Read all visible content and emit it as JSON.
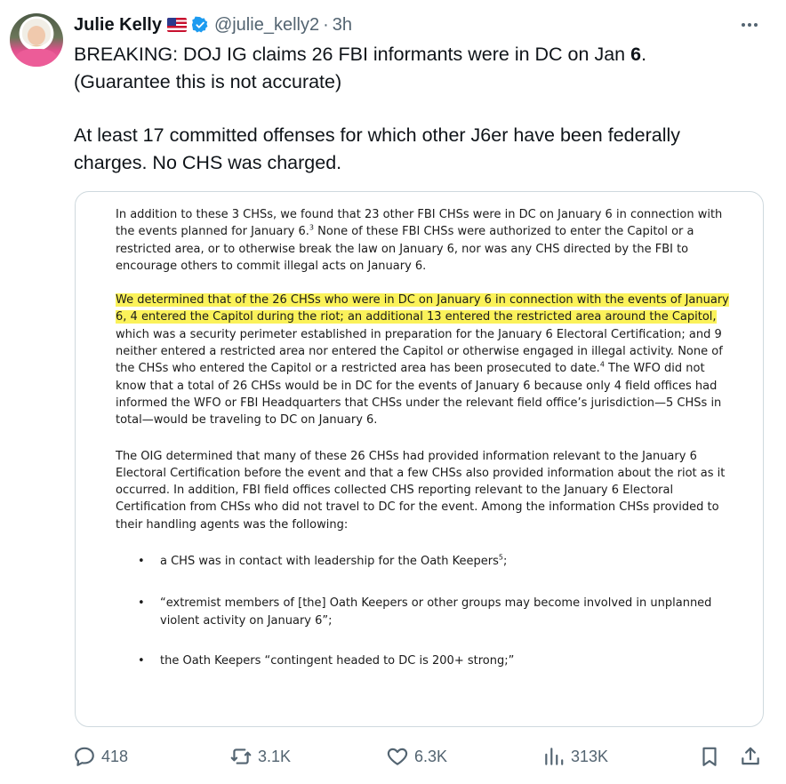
{
  "tweet": {
    "author_name": "Julie Kelly",
    "handle": "@julie_kelly2",
    "separator": "·",
    "time": "3h",
    "flag_icon": "us-flag-icon",
    "verified_color": "#1d9bf0",
    "text_line1_pre": "BREAKING: DOJ IG claims 26 FBI informants were in DC on Jan ",
    "text_line1_bold": "6",
    "text_line1_post": ".",
    "text_line2": "(Guarantee this is not accurate)",
    "text_line3": "At least 17 committed offenses for which other J6er have been federally charges. No CHS was charged."
  },
  "document": {
    "para1_a": "In addition to these 3 CHSs, we found that 23 other FBI CHSs were in DC on January 6 in connection with the events planned for January 6.",
    "para1_sup": "3",
    "para1_b": "  None of these FBI CHSs were authorized to enter the Capitol or a restricted area, or to otherwise break the law on January 6, nor was any CHS directed by the FBI to encourage others to commit illegal acts on January 6.",
    "para2_highlight": "We determined that of the 26 CHSs who were in DC on January 6 in connection with the events of January 6, 4 entered the Capitol during the riot; an additional 13 entered the restricted area around the Capitol,",
    "para2_a": " which was a security perimeter established in preparation for the January 6 Electoral Certification; and 9 neither entered a restricted area nor entered the Capitol or otherwise engaged in illegal activity.  None of the CHSs who entered the Capitol or a restricted area has been prosecuted to date.",
    "para2_sup": "4",
    "para2_b": "  The WFO did not know that a total of 26 CHSs would be in DC for the events of January 6 because only 4 field offices had informed the WFO or FBI Headquarters that CHSs under the relevant field office’s jurisdiction—5 CHSs in total—would be traveling to DC on January 6.",
    "para3": "The OIG determined that many of these 26 CHSs had provided information relevant to the January 6 Electoral Certification before the event and that a few CHSs also provided information about the riot as it occurred.  In addition, FBI field offices collected CHS reporting relevant to the January 6 Electoral Certification from CHSs who did not travel to DC for the event.  Among the information CHSs provided to their handling agents was the following:",
    "bullet1_a": "a CHS was in contact with leadership for the Oath Keepers",
    "bullet1_sup": "5",
    "bullet1_b": ";",
    "bullet2": "“extremist members of [the] Oath Keepers or other groups may become involved in unplanned violent activity on January 6”;",
    "bullet3": "the Oath Keepers “contingent headed to DC is 200+ strong;”",
    "highlight_color": "#fbf25a"
  },
  "actions": {
    "replies": "418",
    "reposts": "3.1K",
    "likes": "6.3K",
    "views": "313K"
  }
}
